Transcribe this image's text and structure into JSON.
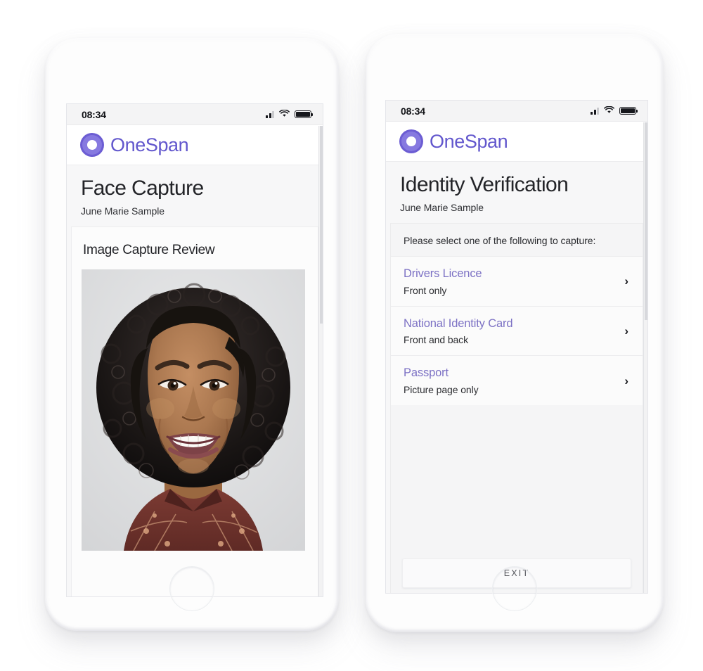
{
  "brand": {
    "name": "OneSpan",
    "logo_icon": "onespan-ring-logo-icon",
    "primary_purple": "#6257cd",
    "link_purple": "#7c71c4"
  },
  "phones": [
    {
      "id": "face-capture",
      "status_bar": {
        "time": "08:34",
        "signal_icon": "cellular-signal-icon",
        "wifi_icon": "wifi-icon",
        "battery_icon": "battery-full-icon"
      },
      "app_bar": {
        "brand_name": "OneSpan"
      },
      "page": {
        "title": "Face Capture",
        "subtitle": "June Marie Sample"
      },
      "review_card": {
        "title": "Image Capture Review",
        "photo_alt": "captured-selfie-portrait"
      }
    },
    {
      "id": "identity-verification",
      "status_bar": {
        "time": "08:34",
        "signal_icon": "cellular-signal-icon",
        "wifi_icon": "wifi-icon",
        "battery_icon": "battery-full-icon"
      },
      "app_bar": {
        "brand_name": "OneSpan"
      },
      "page": {
        "title": "Identity Verification",
        "subtitle": "June Marie Sample"
      },
      "selection": {
        "prompt": "Please select one of the following to capture:",
        "options": [
          {
            "title": "Drivers Licence",
            "subtitle": "Front only",
            "chevron": "›"
          },
          {
            "title": "National Identity Card",
            "subtitle": "Front and back",
            "chevron": "›"
          },
          {
            "title": "Passport",
            "subtitle": "Picture page only",
            "chevron": "›"
          }
        ],
        "exit_label": "EXIT"
      }
    }
  ]
}
